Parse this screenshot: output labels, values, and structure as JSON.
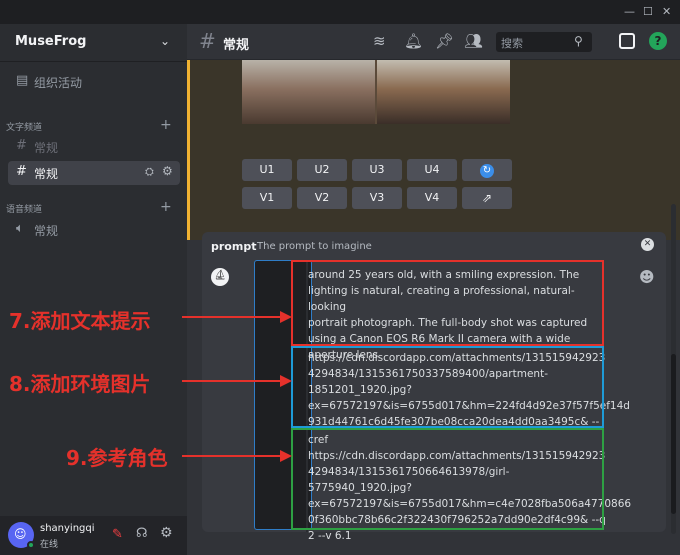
{
  "window": {
    "minimize": "—",
    "maximize": "☐",
    "close": "✕"
  },
  "server": {
    "name": "MuseFrog",
    "items": [
      {
        "label": "组织活动"
      }
    ],
    "categories": [
      {
        "label": "文字频道",
        "channels": [
          "常规",
          "常规"
        ]
      },
      {
        "label": "语音频道",
        "channels": [
          "常规"
        ]
      }
    ]
  },
  "user": {
    "name": "shanyingqi",
    "status": "在线"
  },
  "channel": {
    "name": "常规",
    "search_placeholder": "搜索"
  },
  "buttons": {
    "row1": [
      "U1",
      "U2",
      "U3",
      "U4"
    ],
    "row2": [
      "V1",
      "V2",
      "V3",
      "V4"
    ]
  },
  "composer": {
    "command": "prompt",
    "hint": "The prompt to imagine",
    "block1": "around 25 years old, with a smiling expression. The\nlighting is natural, creating a professional, natural-looking\nportrait photograph. The full-body shot was captured\nusing a Canon EOS R6 Mark II camera with a wide\naperture lens",
    "block2": "https://cdn.discordapp.com/attachments/131515942923\n4294834/1315361750337589400/apartment-\n1851201_1920.jpg?\nex=67572197&is=6755d017&hm=224fd4d92e37f57f5ef14d\n931d44761c6d45fe307be08cca20dea4dd0aa3495c& --",
    "block3": "cref\nhttps://cdn.discordapp.com/attachments/131515942923\n4294834/1315361750664613978/girl-5775940_1920.jpg?\nex=67572197&is=6755d017&hm=c4e7028fba506a4770866\n0f360bbc78b66c2f322430f796252a7dd90e2df4c99& --q\n2 --v 6.1"
  },
  "annotations": {
    "a7": "7.添加文本提示",
    "a8": "8.添加环境图片",
    "a9": "9.参考角色"
  },
  "colors": {
    "red": "#e5312b",
    "blue": "#1e9bd7",
    "green": "#2ea043",
    "accent": "#5865f2"
  }
}
